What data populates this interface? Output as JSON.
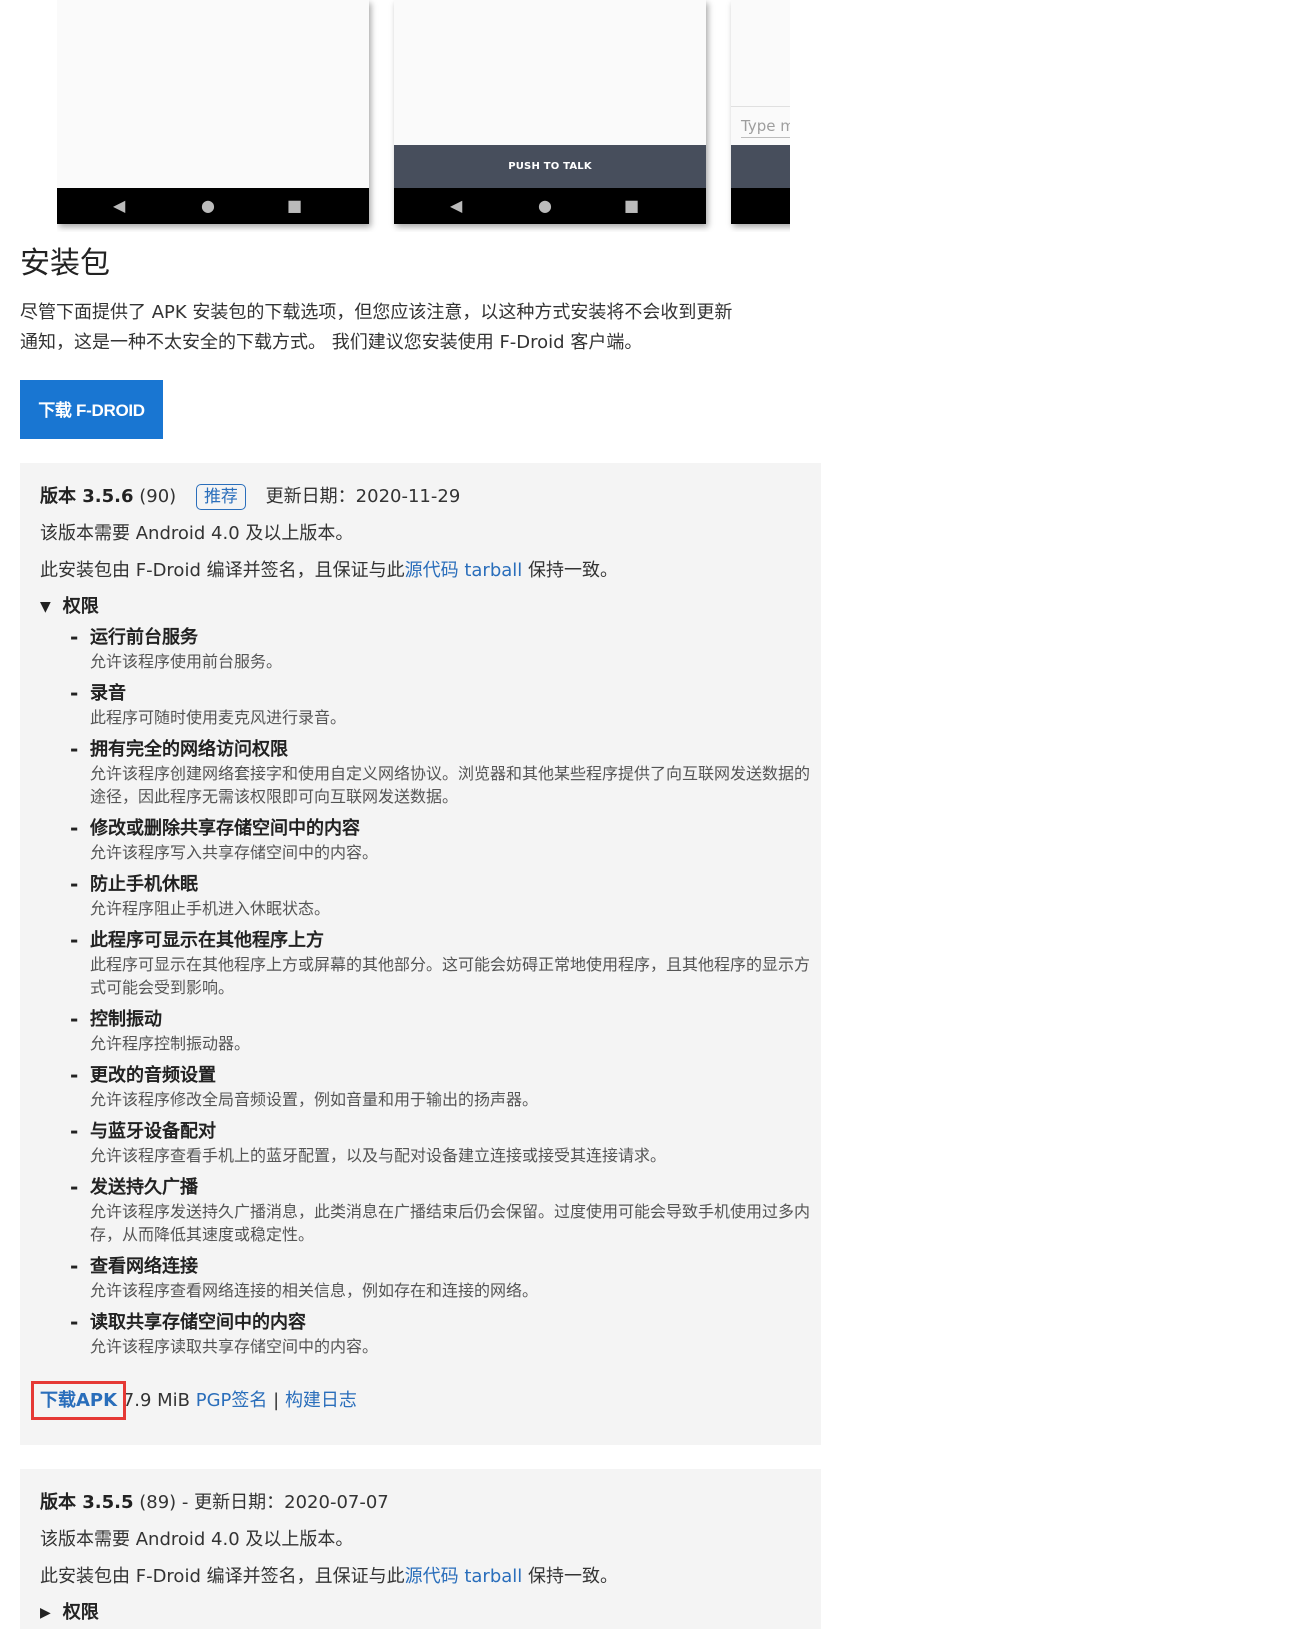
{
  "screenshots": {
    "ptt_label": "PUSH TO TALK",
    "type_hint": "Type m",
    "nav_back": "◀",
    "nav_home": "●",
    "nav_recent": "■"
  },
  "section": {
    "title": "安装包",
    "intro_line1": "尽管下面提供了 APK 安装包的下载选项，但您应该注意，以这种方式安装将不会收到更新",
    "intro_line2": "通知，这是一种不太安全的下载方式。 我们建议您安装使用 F-Droid 客户端。",
    "download_fdroid": "下载 F-DROID"
  },
  "versions": [
    {
      "label": "版本 3.5.6",
      "code": "(90)",
      "badge": "推荐",
      "date": "更新日期：2020-11-29",
      "requirement": "该版本需要 Android 4.0 及以上版本。",
      "signed_prefix": "此安装包由 F-Droid 编译并签名，且保证与此",
      "source_link": "源代码 tarball",
      "signed_suffix": " 保持一致。",
      "permissions_label": "权限",
      "permissions": [
        {
          "name": "运行前台服务",
          "desc": "允许该程序使用前台服务。"
        },
        {
          "name": "录音",
          "desc": "此程序可随时使用麦克风进行录音。"
        },
        {
          "name": "拥有完全的网络访问权限",
          "desc": "允许该程序创建网络套接字和使用自定义网络协议。浏览器和其他某些程序提供了向互联网发送数据的途径，因此程序无需该权限即可向互联网发送数据。"
        },
        {
          "name": "修改或删除共享存储空间中的内容",
          "desc": "允许该程序写入共享存储空间中的内容。"
        },
        {
          "name": "防止手机休眠",
          "desc": "允许程序阻止手机进入休眠状态。"
        },
        {
          "name": "此程序可显示在其他程序上方",
          "desc": "此程序可显示在其他程序上方或屏幕的其他部分。这可能会妨碍正常地使用程序，且其他程序的显示方式可能会受到影响。"
        },
        {
          "name": "控制振动",
          "desc": "允许程序控制振动器。"
        },
        {
          "name": "更改的音频设置",
          "desc": "允许该程序修改全局音频设置，例如音量和用于输出的扬声器。"
        },
        {
          "name": "与蓝牙设备配对",
          "desc": "允许该程序查看手机上的蓝牙配置，以及与配对设备建立连接或接受其连接请求。"
        },
        {
          "name": "发送持久广播",
          "desc": "允许该程序发送持久广播消息，此类消息在广播结束后仍会保留。过度使用可能会导致手机使用过多内存，从而降低其速度或稳定性。"
        },
        {
          "name": "查看网络连接",
          "desc": "允许该程序查看网络连接的相关信息，例如存在和连接的网络。"
        },
        {
          "name": "读取共享存储空间中的内容",
          "desc": "允许该程序读取共享存储空间中的内容。"
        }
      ],
      "download_apk": "下载APK",
      "size": " 7.9 MiB ",
      "pgp": "PGP签名",
      "sep": " | ",
      "build_log": "构建日志"
    },
    {
      "label": "版本 3.5.5",
      "code": "(89)",
      "date": " - 更新日期：2020-07-07",
      "requirement": "该版本需要 Android 4.0 及以上版本。",
      "signed_prefix": "此安装包由 F-Droid 编译并签名，且保证与此",
      "source_link": "源代码 tarball",
      "signed_suffix": " 保持一致。",
      "permissions_label": "权限"
    }
  ]
}
